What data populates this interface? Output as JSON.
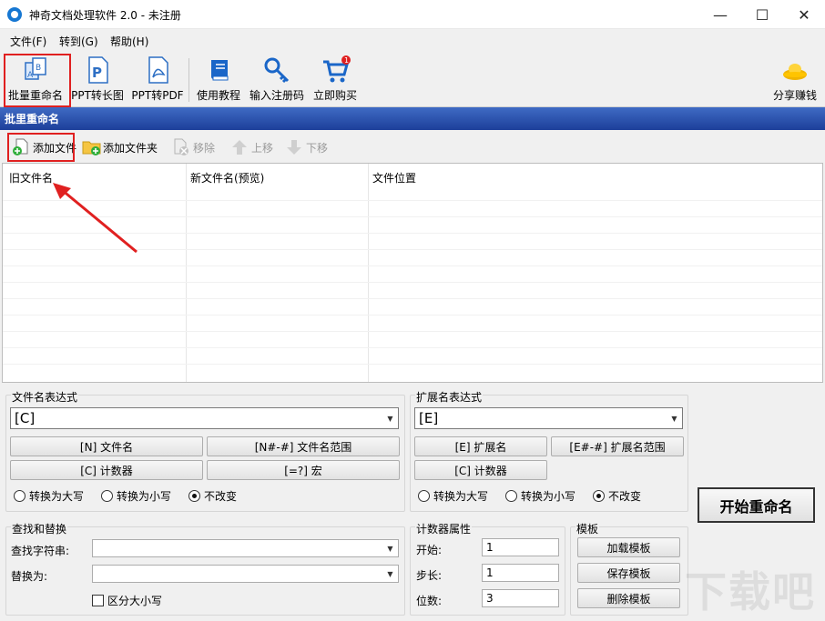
{
  "window": {
    "title": "神奇文档处理软件 2.0 - 未注册",
    "minimize": "—",
    "maximize": "☐",
    "close": "✕"
  },
  "menu": [
    "文件(F)",
    "转到(G)",
    "帮助(H)"
  ],
  "toolbar": {
    "items": [
      {
        "label": "批量重命名",
        "icon": "batch-rename-icon"
      },
      {
        "label": "PPT转长图",
        "icon": "ppt-long-image-icon"
      },
      {
        "label": "PPT转PDF",
        "icon": "ppt-pdf-icon"
      },
      {
        "label": "使用教程",
        "icon": "book-icon"
      },
      {
        "label": "输入注册码",
        "icon": "key-icon"
      },
      {
        "label": "立即购买",
        "icon": "cart-icon",
        "badge": "1"
      }
    ],
    "share_label": "分享赚钱"
  },
  "panel_title": "批里重命名",
  "actions": [
    {
      "label": "添加文件",
      "enabled": true
    },
    {
      "label": "添加文件夹",
      "enabled": true
    },
    {
      "label": "移除",
      "enabled": false
    },
    {
      "label": "上移",
      "enabled": false
    },
    {
      "label": "下移",
      "enabled": false
    }
  ],
  "file_list": {
    "columns": [
      "旧文件名",
      "新文件名(预览)",
      "文件位置"
    ],
    "rows": []
  },
  "filename_expr": {
    "label": "文件名表达式",
    "value": "[C]",
    "buttons": [
      "[N] 文件名",
      "[N#-#] 文件名范围",
      "[C] 计数器",
      "[=?] 宏"
    ],
    "radios": [
      "转换为大写",
      "转换为小写",
      "不改变"
    ],
    "selected": "不改变"
  },
  "ext_expr": {
    "label": "扩展名表达式",
    "value": "[E]",
    "buttons": [
      "[E] 扩展名",
      "[E#-#] 扩展名范围",
      "[C] 计数器"
    ],
    "radios": [
      "转换为大写",
      "转换为小写",
      "不改变"
    ],
    "selected": "不改变"
  },
  "find_replace": {
    "label": "查找和替换",
    "find_label": "查找字符串:",
    "find_value": "",
    "replace_label": "替换为:",
    "replace_value": "",
    "case_label": "区分大小写",
    "case_checked": false
  },
  "counter": {
    "label": "计数器属性",
    "start_label": "开始:",
    "start_value": "1",
    "step_label": "步长:",
    "step_value": "1",
    "digits_label": "位数:",
    "digits_value": "3"
  },
  "templates": {
    "label": "模板",
    "load": "加载模板",
    "save": "保存模板",
    "delete": "删除模板"
  },
  "start_button": "开始重命名",
  "watermark": "下载吧",
  "colors": {
    "header_blue": "#1d3f9a",
    "highlight_red": "#e02020"
  }
}
